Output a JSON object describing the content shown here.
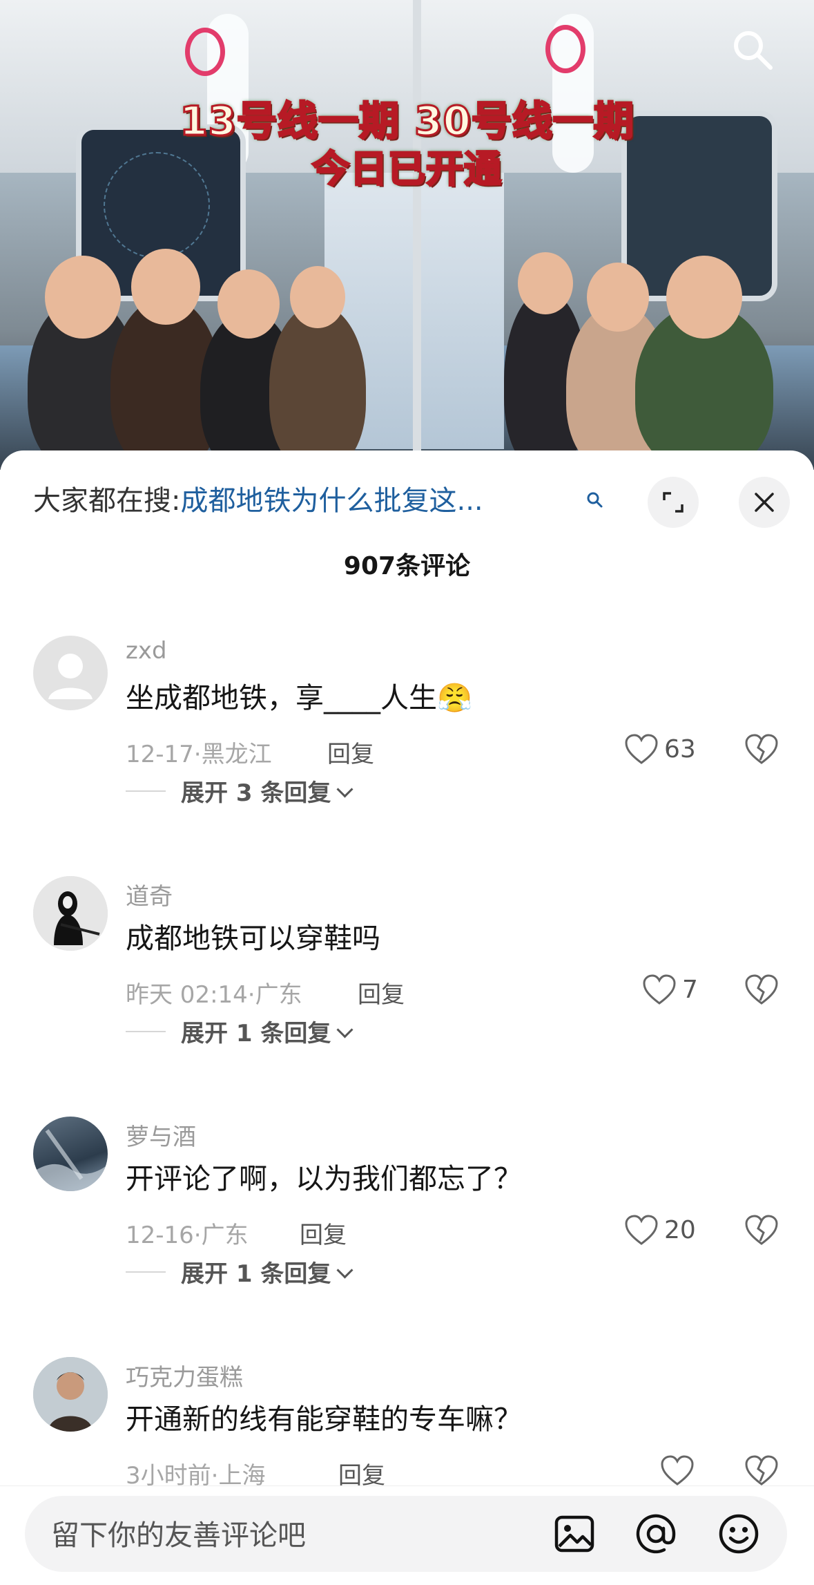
{
  "video": {
    "headline_line1": "13号线一期 30号线一期",
    "headline_line2": "今日已开通"
  },
  "search_hint": {
    "label": "大家都在搜:",
    "query": "成都地铁为什么批复这..."
  },
  "comments_count": "907条评论",
  "comments": [
    {
      "username": "zxd",
      "text": "坐成都地铁，享____人生",
      "emoji": "😤",
      "meta": "12-17·黑龙江",
      "reply": "回复",
      "likes": "63",
      "expand": "展开 3 条回复"
    },
    {
      "username": "道奇",
      "text": "成都地铁可以穿鞋吗",
      "meta": "昨天 02:14·广东",
      "reply": "回复",
      "likes": "7",
      "expand": "展开 1 条回复"
    },
    {
      "username": "萝与酒",
      "text": "开评论了啊，以为我们都忘了？",
      "meta": "12-16·广东",
      "reply": "回复",
      "likes": "20",
      "expand": "展开 1 条回复"
    },
    {
      "username": "巧克力蛋糕",
      "text": "开通新的线有能穿鞋的专车嘛？",
      "meta": "3小时前·上海",
      "reply": "回复",
      "likes": ""
    }
  ],
  "input": {
    "placeholder": "留下你的友善评论吧"
  },
  "colors": {
    "accent_link": "#1f5f9e",
    "headline_red": "#b71a25"
  }
}
